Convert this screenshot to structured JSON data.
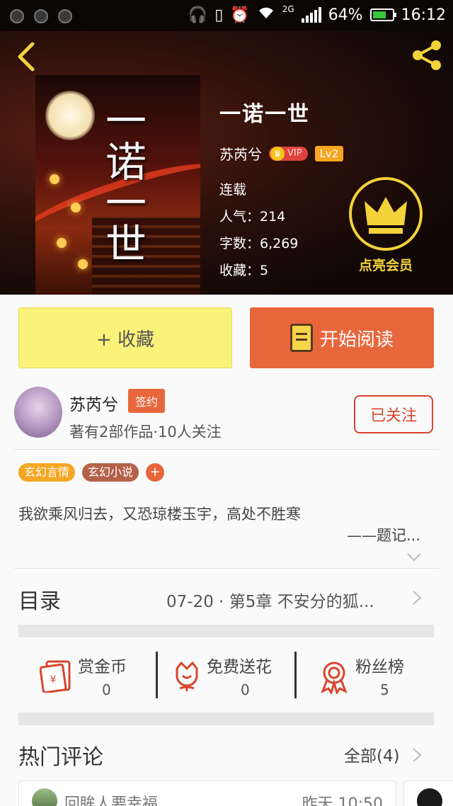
{
  "status_bar": {
    "network": "2G",
    "battery": "64%",
    "time": "16:12"
  },
  "book": {
    "title": "一诺一世",
    "cover_title": "一诺一世",
    "author": "苏芮兮",
    "vip_label": "VIP",
    "level": "Lv2",
    "status": "连载",
    "popularity": "人气：214",
    "word_count": "字数：6,269",
    "favorites": "收藏：5"
  },
  "member": {
    "label": "点亮会员"
  },
  "actions": {
    "collect": "+ 收藏",
    "read": "开始阅读"
  },
  "author_card": {
    "name": "苏芮兮",
    "badge": "签约",
    "desc": "著有2部作品·10人关注",
    "follow": "已关注"
  },
  "tags": [
    {
      "label": "玄幻言情",
      "color": "#f5a623"
    },
    {
      "label": "玄幻小说",
      "color": "#b5614a"
    }
  ],
  "intro": {
    "text": "我欲乘风归去，又恐琼楼玉宇，高处不胜寒",
    "signature": "——题记..."
  },
  "catalog": {
    "label": "目录",
    "latest": "07-20 · 第5章  不安分的狐..."
  },
  "stats": [
    {
      "label": "赏金币",
      "value": "0",
      "icon": "red-envelope-icon"
    },
    {
      "label": "免费送花",
      "value": "0",
      "icon": "flower-icon"
    },
    {
      "label": "粉丝榜",
      "value": "5",
      "icon": "medal-icon"
    }
  ],
  "comments": {
    "title": "热门评论",
    "all": "全部(4)",
    "items": [
      {
        "user": "回眸人要幸福",
        "time": "昨天 10:50"
      }
    ]
  },
  "colors": {
    "accent": "#e8663c",
    "collect_bg": "#fbf27a",
    "member_gold": "#f3d23a"
  }
}
